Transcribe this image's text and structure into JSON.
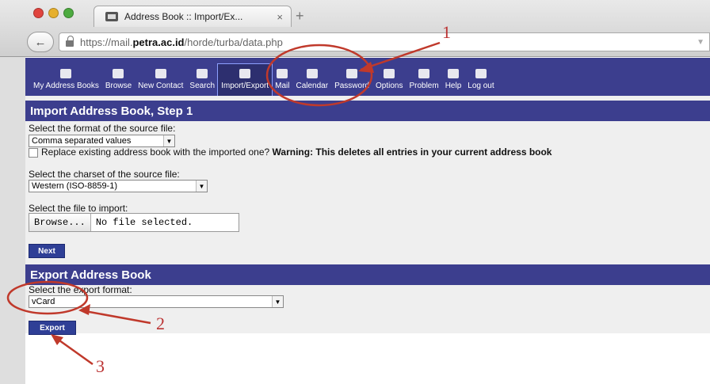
{
  "browser": {
    "tab_title": "Address Book :: Import/Ex...",
    "tab_close": "×",
    "new_tab": "+",
    "url_prefix": "https://mail.",
    "url_host": "petra.ac.id",
    "url_path": "/horde/turba/data.php"
  },
  "nav": {
    "items": [
      {
        "label": "My Address Books",
        "icon": "addressbook-icon"
      },
      {
        "label": "Browse",
        "icon": "browse-icon"
      },
      {
        "label": "New Contact",
        "icon": "new-contact-icon"
      },
      {
        "label": "Search",
        "icon": "search-icon"
      },
      {
        "label": "Import/Export",
        "icon": "import-export-icon"
      },
      {
        "label": "Mail",
        "icon": "mail-icon"
      },
      {
        "label": "Calendar",
        "icon": "calendar-icon"
      },
      {
        "label": "Password",
        "icon": "password-icon"
      },
      {
        "label": "Options",
        "icon": "options-icon"
      },
      {
        "label": "Problem",
        "icon": "problem-icon"
      },
      {
        "label": "Help",
        "icon": "help-icon"
      },
      {
        "label": "Log out",
        "icon": "logout-icon"
      }
    ],
    "active": "Import/Export"
  },
  "import": {
    "header": "Import Address Book, Step 1",
    "format_label": "Select the format of the source file:",
    "format_value": "Comma separated values",
    "replace_label": "Replace existing address book with the imported one?",
    "warning": "Warning: This deletes all entries in your current address book",
    "charset_label": "Select the charset of the source file:",
    "charset_value": "Western (ISO-8859-1)",
    "file_label": "Select the file to import:",
    "browse_label": "Browse...",
    "no_file": "No file selected.",
    "next_label": "Next"
  },
  "export": {
    "header": "Export Address Book",
    "format_label": "Select the export format:",
    "format_value": "vCard",
    "export_label": "Export"
  },
  "annotations": {
    "one": "1",
    "two": "2",
    "three": "3",
    "color": "#c0392b"
  },
  "colors": {
    "nav_bg": "#3c3e8e",
    "header_bg": "#3c3e8e",
    "button_bg": "#2f3f96"
  }
}
